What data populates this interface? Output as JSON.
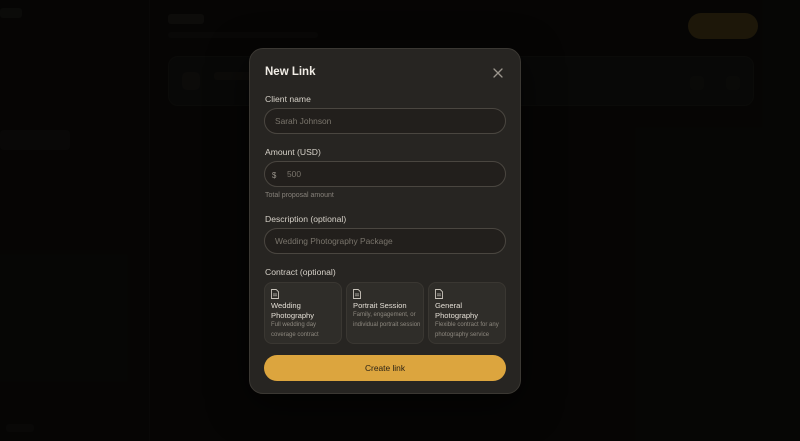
{
  "modal": {
    "title": "New Link",
    "close_icon": "close-icon"
  },
  "form": {
    "client_name": {
      "label": "Client name",
      "placeholder": "Sarah Johnson",
      "value": ""
    },
    "amount": {
      "label": "Amount (USD)",
      "currency_symbol": "$",
      "placeholder": "500",
      "hint": "Total proposal amount"
    },
    "description": {
      "label": "Description (optional)",
      "placeholder": "Wedding Photography Package"
    },
    "contract": {
      "label": "Contract (optional)",
      "options": [
        {
          "title": "Wedding Photography",
          "description": "Full wedding day coverage contract",
          "icon": "document-icon"
        },
        {
          "title": "Portrait Session",
          "description": "Family, engagement, or individual portrait session",
          "icon": "document-icon"
        },
        {
          "title": "General Photography",
          "description": "Flexible contract for any photography service",
          "icon": "document-icon"
        }
      ]
    },
    "submit_label": "Create link"
  },
  "colors": {
    "accent": "#dca53e",
    "modal_bg": "#272522",
    "page_bg": "#0e0d0b"
  }
}
